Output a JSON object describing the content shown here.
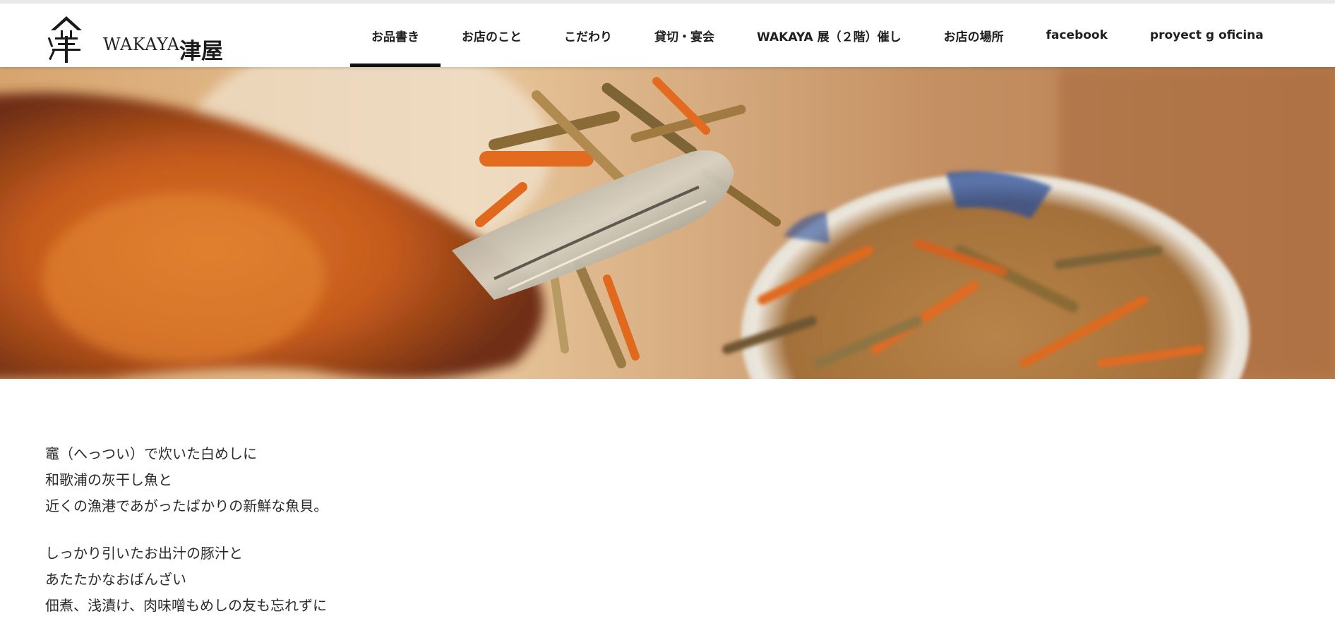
{
  "header": {
    "logo": {
      "mark": "津",
      "name": "WAKAYA",
      "kanji": "津屋"
    },
    "nav": [
      {
        "label": "お品書き",
        "active": true
      },
      {
        "label": "お店のこと",
        "active": false
      },
      {
        "label": "こだわり",
        "active": false
      },
      {
        "label": "貸切・宴会",
        "active": false
      },
      {
        "label": "WAKAYA 展（２階）催し",
        "active": false
      },
      {
        "label": "お店の場所",
        "active": false
      },
      {
        "label": "facebook",
        "active": false
      },
      {
        "label": "proyect g oficina",
        "active": false
      }
    ]
  },
  "hero": {
    "alt": "hero-food-photo"
  },
  "intro": {
    "paragraphs": [
      [
        "竈（へっつい）で炊いた白めしに",
        "和歌浦の灰干し魚と",
        "近くの漁港であがったばかりの新鮮な魚貝。"
      ],
      [
        "しっかり引いたお出汁の豚汁と",
        "あたたかなおばんざい",
        "佃煮、浅漬け、肉味噌もめしの友も忘れずに"
      ]
    ]
  },
  "colors": {
    "active_underline": "#111111",
    "text": "#2b2b2b",
    "nav_text": "#1f1f1f"
  }
}
